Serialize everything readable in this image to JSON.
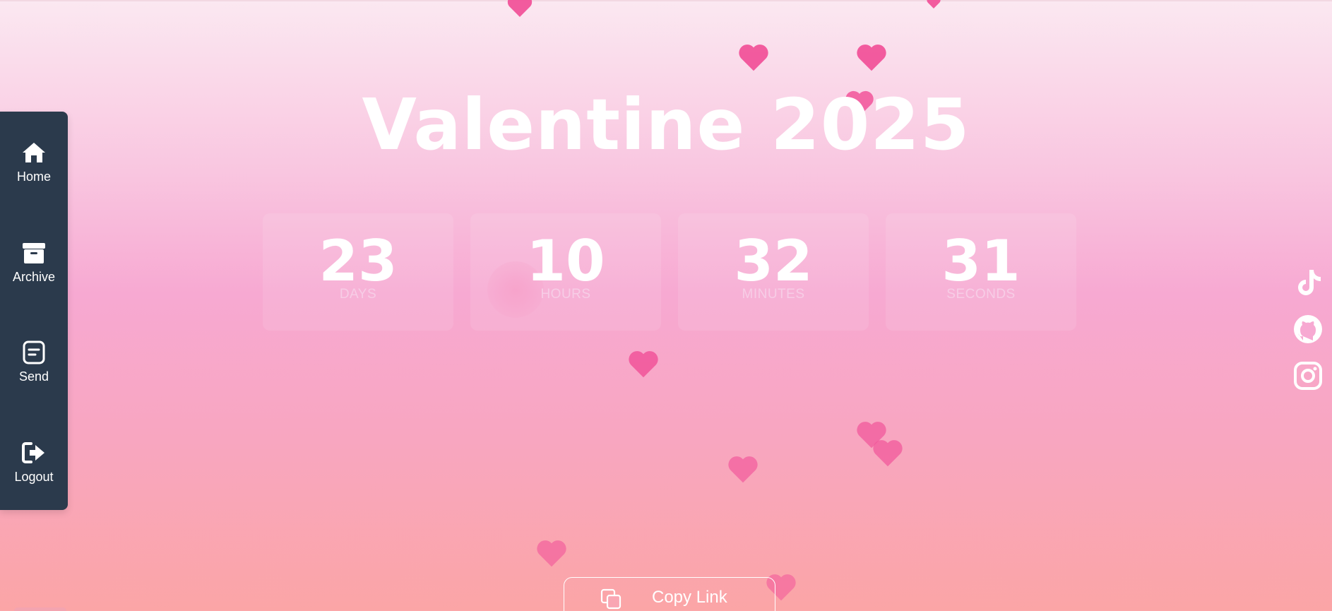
{
  "app": {
    "title": "Valentine 2025"
  },
  "sidebar": {
    "items": [
      {
        "label": "Home",
        "icon": "home-icon"
      },
      {
        "label": "Archive",
        "icon": "archive-icon"
      },
      {
        "label": "Send",
        "icon": "send-icon"
      },
      {
        "label": "Logout",
        "icon": "logout-icon"
      }
    ]
  },
  "countdown": {
    "days": {
      "value": "23",
      "label": "DAYS"
    },
    "hours": {
      "value": "10",
      "label": "HOURS"
    },
    "minutes": {
      "value": "32",
      "label": "MINUTES"
    },
    "seconds": {
      "value": "31",
      "label": "SECONDS"
    }
  },
  "social": {
    "icons": [
      "tiktok-icon",
      "github-icon",
      "instagram-icon"
    ]
  },
  "actions": {
    "copy_link_label": "Copy Link"
  },
  "colors": {
    "sidebar_bg": "#2b3a4c",
    "heart": "#f2549a",
    "text": "#ffffff",
    "count_label": "#f7cde6"
  }
}
